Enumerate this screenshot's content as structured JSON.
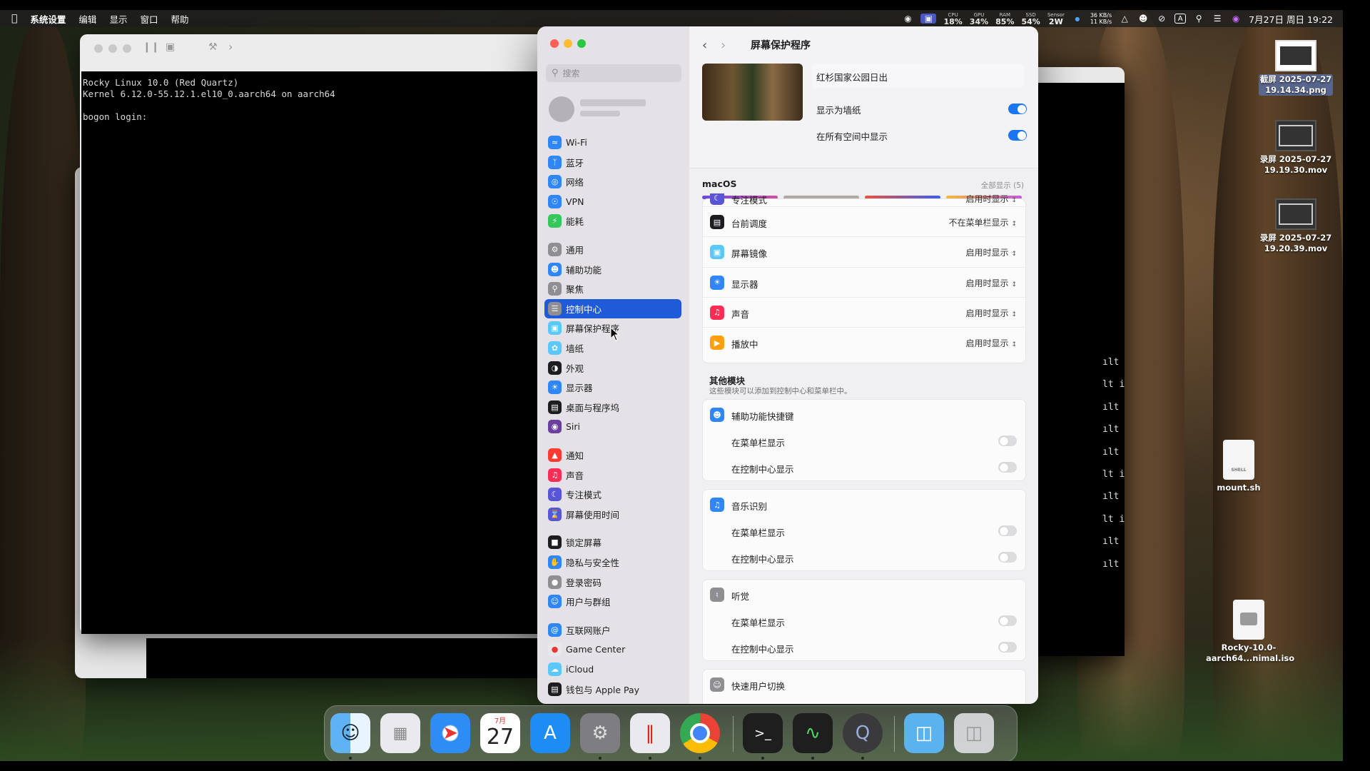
{
  "menubar": {
    "app_name": "系统设置",
    "menus": [
      "编辑",
      "显示",
      "窗口",
      "帮助"
    ],
    "stats": [
      {
        "label": "CPU",
        "value": "18%"
      },
      {
        "label": "GPU",
        "value": "34%"
      },
      {
        "label": "RAM",
        "value": "85%"
      },
      {
        "label": "SSD",
        "value": "54%"
      },
      {
        "label": "Sensor",
        "value": "2W"
      }
    ],
    "net_up": "36 KB/s",
    "net_down": "11 KB/s",
    "input_method": "A",
    "datetime": "7月27日 周日 19:22"
  },
  "terminal": {
    "lines": [
      "Rocky Linux 10.0 (Red Quartz)",
      "Kernel 6.12.0-55.12.1.el10_0.aarch64 on aarch64",
      "",
      "bogon login:"
    ],
    "gutter": [
      "ılt",
      "lt i",
      "ılt",
      "ılt",
      "ılt",
      "lt i",
      "ılt",
      "lt i",
      "ılt",
      "ılt"
    ]
  },
  "settings": {
    "search_placeholder": "搜索",
    "sidebar": [
      {
        "label": "Wi-Fi",
        "icon": "wifi-icon",
        "color": "#2f86f6"
      },
      {
        "label": "蓝牙",
        "icon": "bluetooth-icon",
        "color": "#2f86f6"
      },
      {
        "label": "网络",
        "icon": "globe-icon",
        "color": "#2f86f6"
      },
      {
        "label": "VPN",
        "icon": "vpn-icon",
        "color": "#2f86f6"
      },
      {
        "label": "能耗",
        "icon": "battery-icon",
        "color": "#34c759"
      },
      {
        "label": "通用",
        "icon": "gear-icon",
        "color": "#8e8e93"
      },
      {
        "label": "辅助功能",
        "icon": "accessibility-icon",
        "color": "#2f86f6"
      },
      {
        "label": "聚焦",
        "icon": "search-icon",
        "color": "#8e8e93"
      },
      {
        "label": "控制中心",
        "icon": "control-center-icon",
        "color": "#8e8e93"
      },
      {
        "label": "屏幕保护程序",
        "icon": "screensaver-icon",
        "color": "#5ac8fa"
      },
      {
        "label": "墙纸",
        "icon": "wallpaper-icon",
        "color": "#5ac8fa"
      },
      {
        "label": "外观",
        "icon": "appearance-icon",
        "color": "#1d1d1f"
      },
      {
        "label": "显示器",
        "icon": "display-icon",
        "color": "#2f86f6"
      },
      {
        "label": "桌面与程序坞",
        "icon": "dock-icon",
        "color": "#1d1d1f"
      },
      {
        "label": "Siri",
        "icon": "siri-icon",
        "color": "#6b3fa0"
      },
      {
        "label": "通知",
        "icon": "notification-icon",
        "color": "#ff3b30"
      },
      {
        "label": "声音",
        "icon": "sound-icon",
        "color": "#ff2d55"
      },
      {
        "label": "专注模式",
        "icon": "focus-icon",
        "color": "#5856d6"
      },
      {
        "label": "屏幕使用时间",
        "icon": "screen-time-icon",
        "color": "#5856d6"
      },
      {
        "label": "锁定屏幕",
        "icon": "lock-icon",
        "color": "#1d1d1f"
      },
      {
        "label": "隐私与安全性",
        "icon": "hand-icon",
        "color": "#2f86f6"
      },
      {
        "label": "登录密码",
        "icon": "password-icon",
        "color": "#8e8e93"
      },
      {
        "label": "用户与群组",
        "icon": "users-icon",
        "color": "#2f86f6"
      },
      {
        "label": "互联网账户",
        "icon": "at-icon",
        "color": "#2f86f6"
      },
      {
        "label": "Game Center",
        "icon": "game-center-icon",
        "color": "#e8e8ea"
      },
      {
        "label": "iCloud",
        "icon": "cloud-icon",
        "color": "#5ac8fa"
      },
      {
        "label": "钱包与 Apple Pay",
        "icon": "wallet-icon",
        "color": "#1d1d1f"
      }
    ],
    "selected_index": 8,
    "page_title": "屏幕保护程序",
    "saver_name": "红杉国家公园日出",
    "show_as_wallpaper": "显示为墙纸",
    "show_all_spaces": "在所有空间中显示",
    "macos_label": "macOS",
    "show_all": "全部显示 (5)",
    "partial_row": {
      "label": "专注模式",
      "value": "启用时显示"
    },
    "modules": [
      {
        "label": "台前调度",
        "value": "不在菜单栏显示",
        "icon": "stage-manager-icon",
        "color": "#1d1d1f"
      },
      {
        "label": "屏幕镜像",
        "value": "启用时显示",
        "icon": "screen-mirror-icon",
        "color": "#5ac8fa"
      },
      {
        "label": "显示器",
        "value": "启用时显示",
        "icon": "display-icon",
        "color": "#2f86f6"
      },
      {
        "label": "声音",
        "value": "启用时显示",
        "icon": "sound-icon",
        "color": "#ff2d55"
      },
      {
        "label": "播放中",
        "value": "启用时显示",
        "icon": "now-playing-icon",
        "color": "#ff9f0a"
      }
    ],
    "other_title": "其他模块",
    "other_subtitle": "这些模块可以添加到控制中心和菜单栏中。",
    "other_modules": [
      {
        "label": "辅助功能快捷键",
        "icon": "accessibility-icon",
        "color": "#2f86f6"
      },
      {
        "label": "音乐识别",
        "icon": "shazam-icon",
        "color": "#2f86f6"
      },
      {
        "label": "听觉",
        "icon": "hearing-icon",
        "color": "#8e8e93"
      }
    ],
    "in_menubar": "在菜单栏显示",
    "in_control_center": "在控制中心显示",
    "fast_user_switch": "快速用户切换"
  },
  "desktop": {
    "icons": [
      {
        "line1": "截屏 2025-07-27",
        "line2": "19.14.34.png"
      },
      {
        "line1": "录屏 2025-07-27",
        "line2": "19.19.30.mov"
      },
      {
        "line1": "录屏 2025-07-27",
        "line2": "19.20.39.mov"
      },
      {
        "line1": "mount.sh",
        "line2": "",
        "tag": "SHELL"
      },
      {
        "line1": "Rocky-10.0-",
        "line2": "aarch64...nimal.iso"
      }
    ]
  },
  "dock": {
    "calendar_month": "7月",
    "calendar_day": "27",
    "apps": [
      "Finder",
      "Launchpad",
      "Safari",
      "Calendar",
      "App Store",
      "System Settings",
      "Parallels",
      "Chrome",
      "Terminal",
      "Activity Monitor",
      "QuickTime",
      "Folder",
      "Trash"
    ]
  }
}
